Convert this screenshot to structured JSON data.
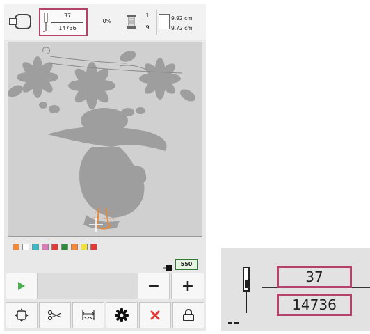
{
  "stitch_counter": {
    "current": "37",
    "total": "14736"
  },
  "progress": {
    "percent_text": "0%"
  },
  "color_counter": {
    "current": "1",
    "total": "9"
  },
  "design_size": {
    "width": "9.92 cm",
    "height": "9.72 cm"
  },
  "thread_colors": [
    "#f08a3a",
    "#ffffff",
    "#3ab7c8",
    "#d97bb8",
    "#e53935",
    "#2e8b3c",
    "#f08a3a",
    "#f3e13a",
    "#e53935"
  ],
  "counter_badge": "550",
  "accent_colors": {
    "selection_border": "#b5426b",
    "play_green": "#4caf50",
    "cancel_red": "#e53935",
    "counter_green": "#2e7d32"
  },
  "icons": [
    "hoop-icon",
    "needle-icon",
    "spool-icon",
    "design-size-icon",
    "play-icon",
    "minus-icon",
    "plus-icon",
    "frame-move-icon",
    "scissors-icon",
    "tension-icon",
    "settings-icon",
    "cancel-icon",
    "lock-icon"
  ],
  "controls": {
    "minus": "−",
    "plus": "+"
  },
  "zoom_inset": {
    "current": "37",
    "total": "14736"
  }
}
